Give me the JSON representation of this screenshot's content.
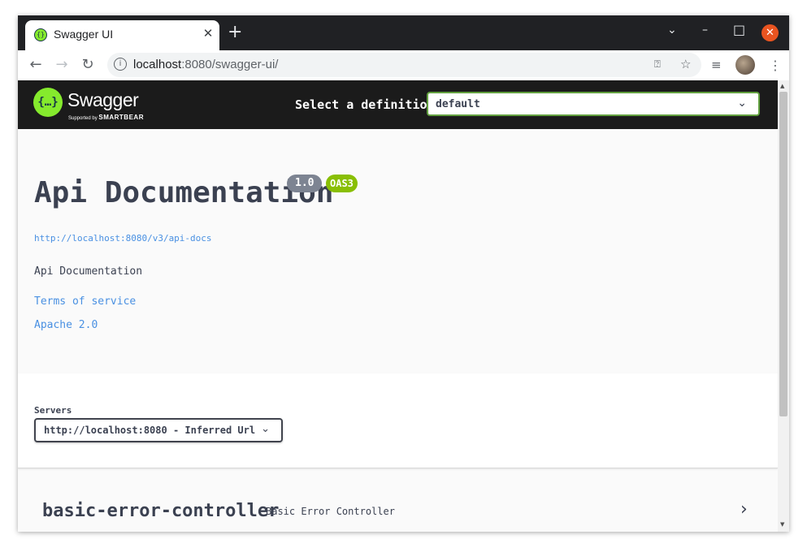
{
  "browser": {
    "tab_title": "Swagger UI",
    "tab_close": "✕",
    "new_tab": "+",
    "url_host": "localhost",
    "url_rest": ":8080/swagger-ui/",
    "controls": {
      "minimize": "–",
      "maximize": "□",
      "close": "✕",
      "tabs_menu": "⌄"
    }
  },
  "swagger": {
    "logo_mark": "{…}",
    "logo_text": "Swagger",
    "logo_sub_prefix": "Supported by ",
    "logo_sub_brand": "SMARTBEAR",
    "definition_label": "Select a definition",
    "definition_value": "default",
    "info": {
      "title": "Api Documentation",
      "version": "1.0",
      "oas_badge": "OAS3",
      "url": "http://localhost:8080/v3/api-docs",
      "description": "Api Documentation",
      "terms": "Terms of service",
      "license": "Apache 2.0"
    },
    "servers": {
      "label": "Servers",
      "selected": "http://localhost:8080 - Inferred Url"
    },
    "tags": [
      {
        "name": "basic-error-controller",
        "description": "Basic Error Controller"
      }
    ]
  },
  "colors": {
    "swagger_green": "#85ea2d",
    "topbar": "#1b1b1b",
    "link": "#4990e2",
    "version_badge": "#7d8492",
    "oas_badge": "#89bf04",
    "ubuntu_close": "#e95420"
  }
}
